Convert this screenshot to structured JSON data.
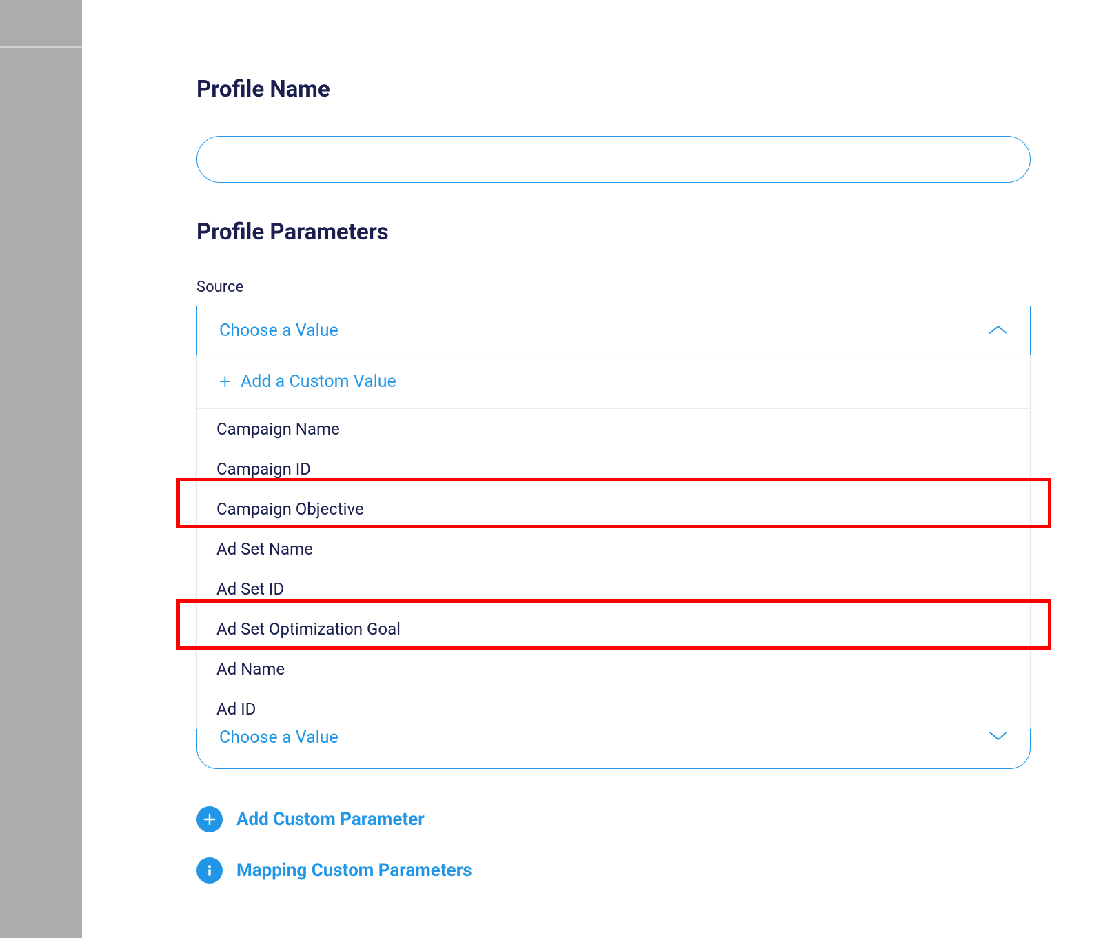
{
  "sections": {
    "profile_name_title": "Profile Name",
    "profile_parameters_title": "Profile Parameters"
  },
  "source": {
    "label": "Source",
    "placeholder": "Choose a Value",
    "add_custom_label": "Add a Custom Value",
    "options": [
      "Campaign Name",
      "Campaign ID",
      "Campaign Objective",
      "Ad Set Name",
      "Ad Set ID",
      "Ad Set Optimization Goal",
      "Ad Name",
      "Ad ID"
    ]
  },
  "secondary_select_placeholder": "Choose a Value",
  "actions": {
    "add_custom_parameter": "Add Custom Parameter",
    "mapping_custom_parameters": "Mapping Custom Parameters"
  },
  "colors": {
    "accent": "#2196e6",
    "heading": "#1a1f4f",
    "highlight": "#ff0000"
  }
}
